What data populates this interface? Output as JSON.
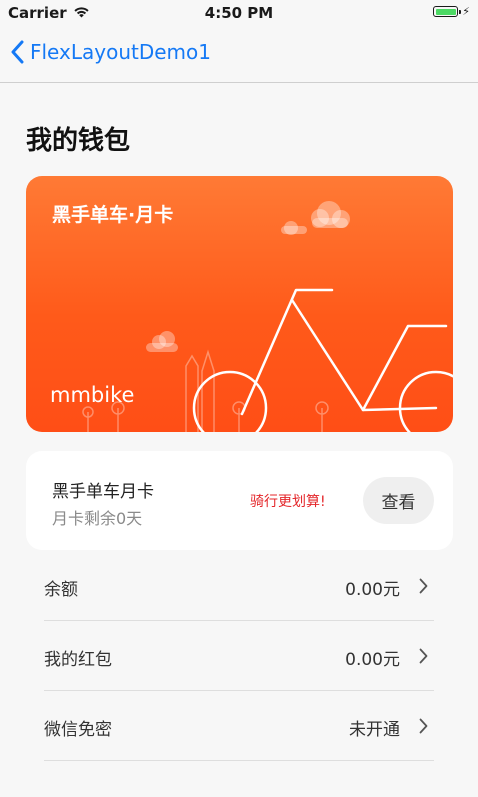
{
  "status_bar": {
    "carrier": "Carrier",
    "time": "4:50 PM",
    "battery_level": 1.0,
    "battery_color": "#4cd964"
  },
  "nav": {
    "back_label": "FlexLayoutDemo1",
    "accent_color": "#1579f5"
  },
  "page": {
    "title": "我的钱包"
  },
  "card": {
    "title": "黑手单车·月卡",
    "brand": "mmbike",
    "gradient": [
      "#ff7a35",
      "#ff4e16"
    ]
  },
  "monthly_card": {
    "title": "黑手单车月卡",
    "subtitle": "月卡剩余0天",
    "promo": "骑行更划算!",
    "view_label": "查看",
    "promo_color": "#e4262a"
  },
  "list": [
    {
      "label": "余额",
      "value": "0.00元"
    },
    {
      "label": "我的红包",
      "value": "0.00元"
    },
    {
      "label": "微信免密",
      "value": "未开通"
    }
  ],
  "icons": {
    "wifi": "wifi-icon",
    "battery": "battery-icon",
    "back": "chevron-left-icon",
    "row": "chevron-right-icon"
  }
}
